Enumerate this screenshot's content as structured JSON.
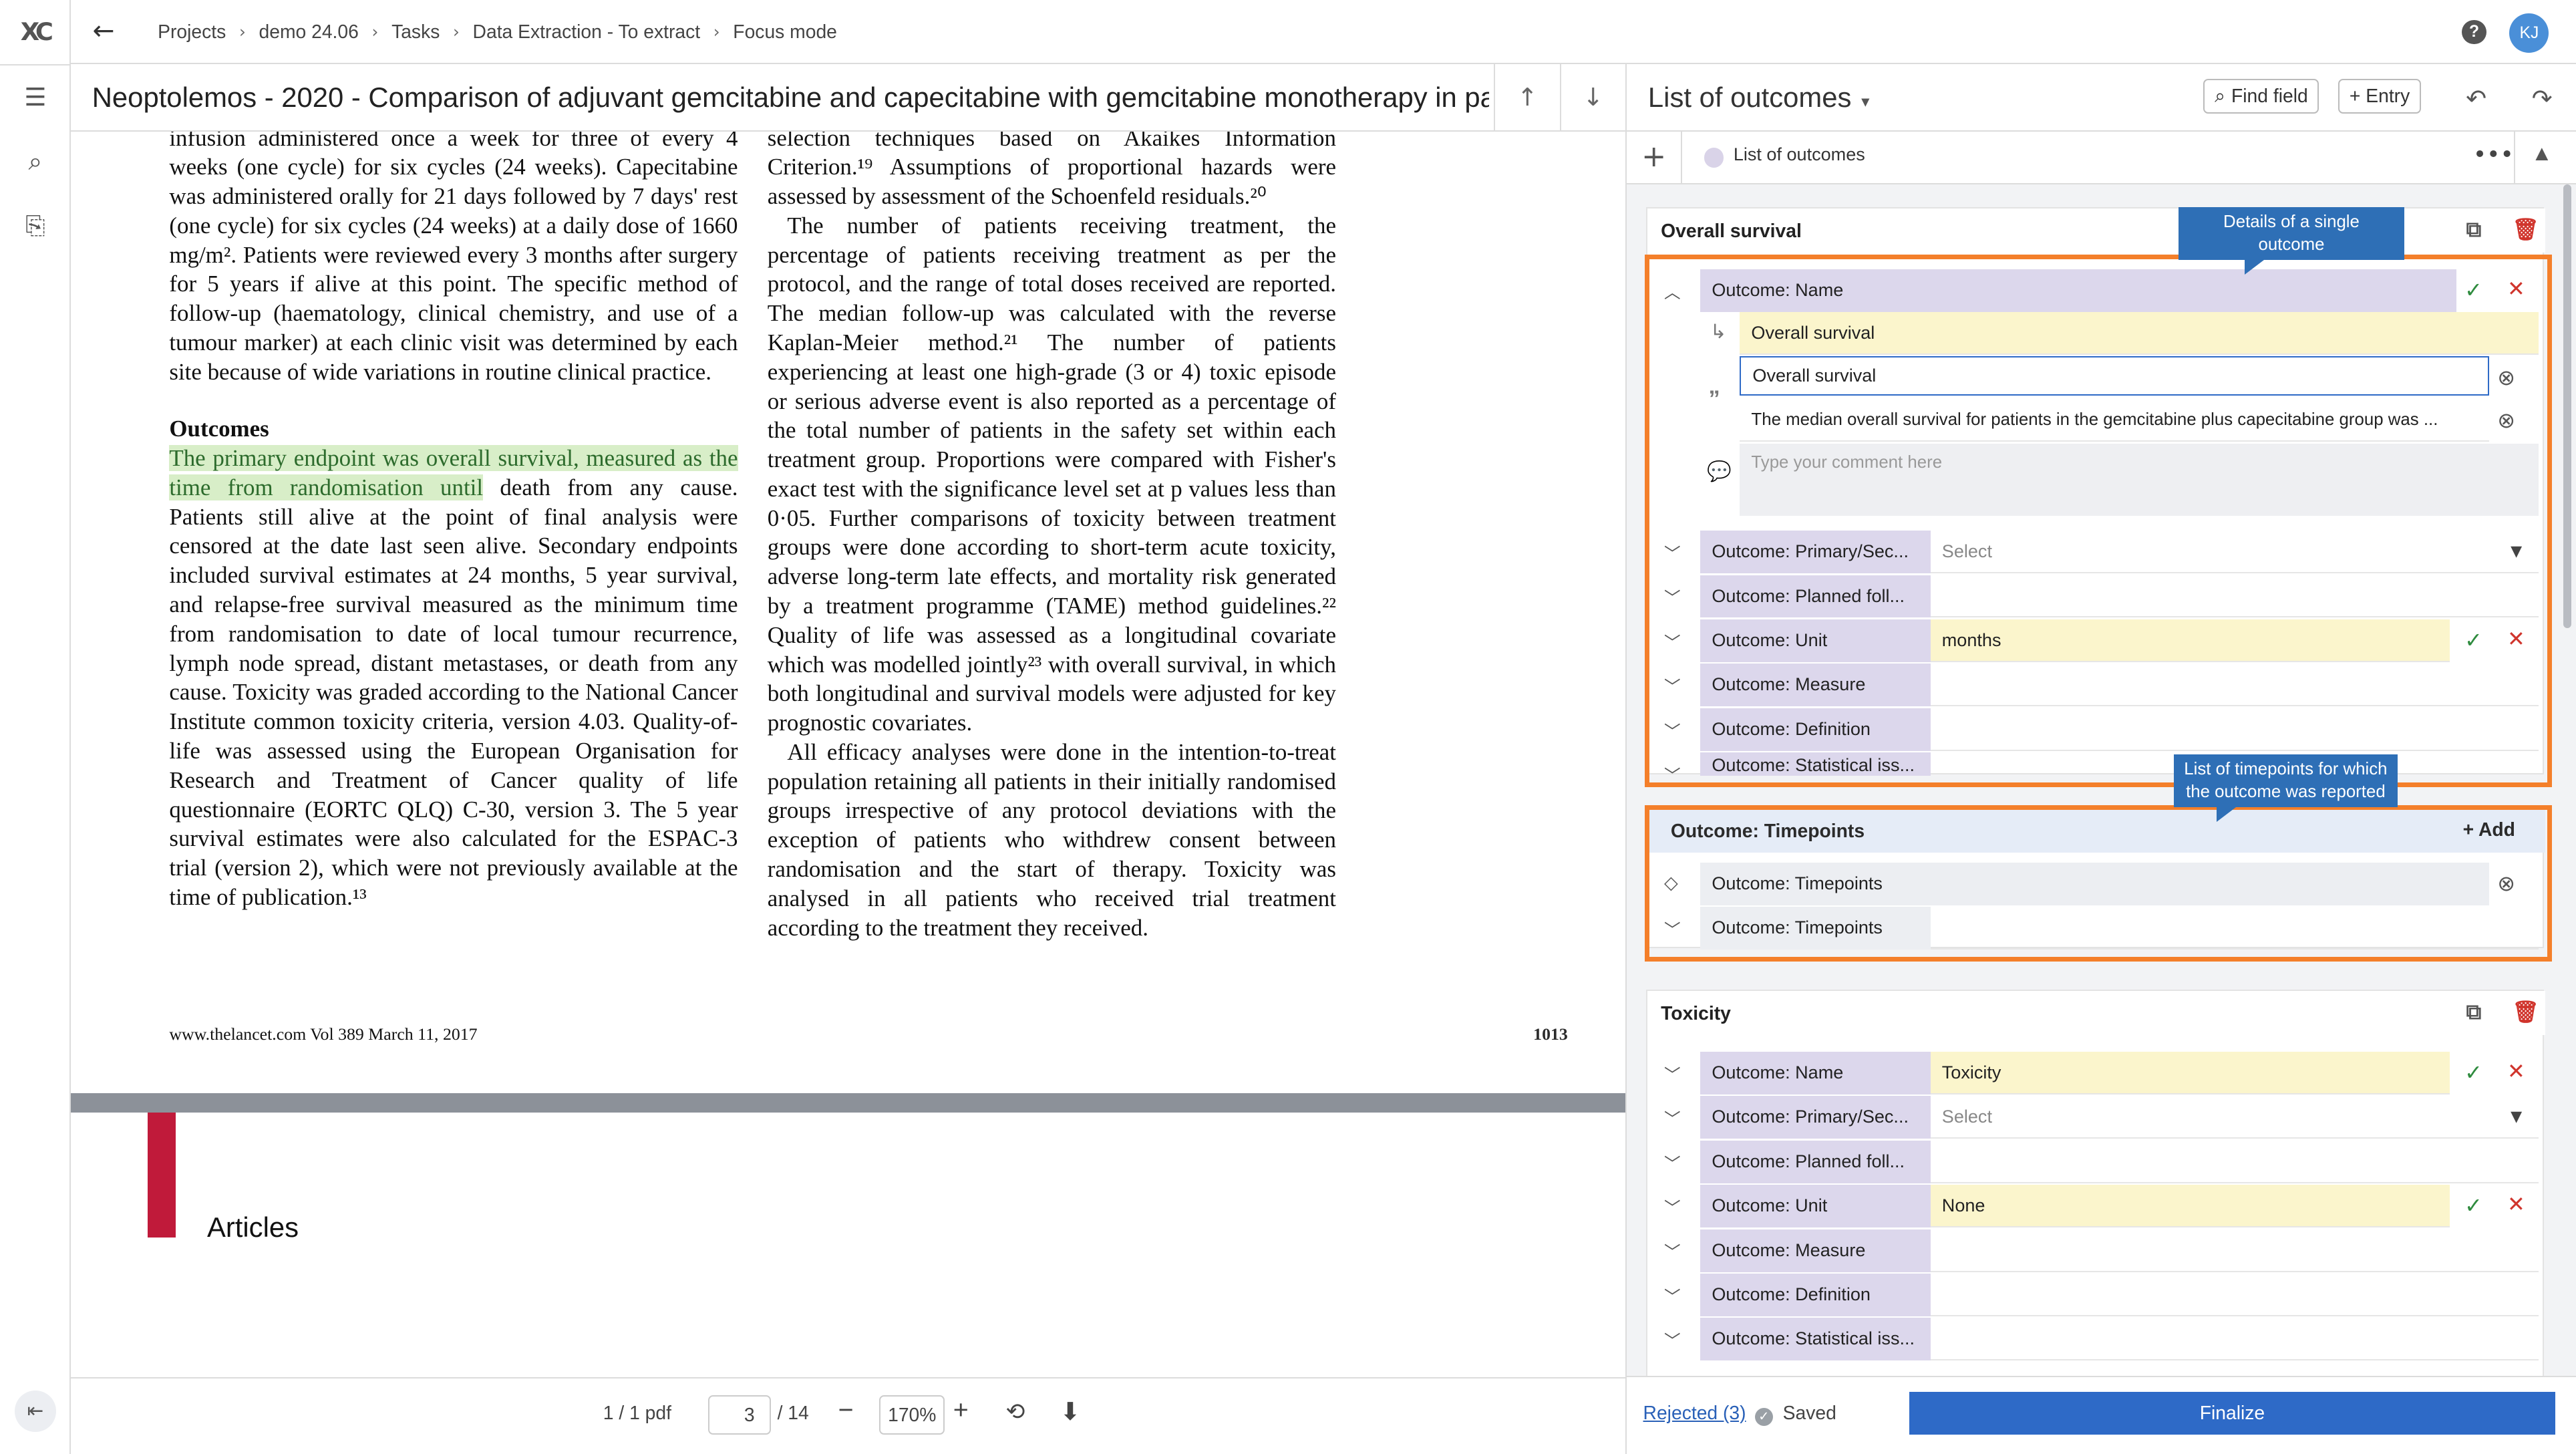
{
  "app": {
    "logo": "XC"
  },
  "breadcrumb": [
    "Projects",
    "demo 24.06",
    "Tasks",
    "Data Extraction - To extract",
    "Focus mode"
  ],
  "user": {
    "initials": "KJ"
  },
  "document": {
    "title": "Neoptolemos - 2020 - Comparison of adjuvant gemcitabine and capecitabine with gemcitabine monotherapy in pa...",
    "col1_intro": "infusion administered once a week for three of every 4 weeks (one cycle) for six cycles (24 weeks). Capecitabine was administered orally for 21 days followed by 7 days' rest (one cycle) for six cycles (24 weeks) at a daily dose of 1660 mg/m². Patients were reviewed every 3 months after surgery for 5 years if alive at this point. The specific method of follow-up (haematology, clinical chemistry, and use of a tumour marker) at each clinic visit was determined by each site because of wide variations in routine clinical practice.",
    "outcomes_heading": "Outcomes",
    "highlight": "The primary endpoint was overall survival, measured as the time from randomisation until",
    "col1_outcomes_rest": " death from any cause. Patients still alive at the point of final analysis were censored at the date last seen alive. Secondary endpoints included survival estimates at 24 months, 5 year survival, and relapse-free survival measured as the minimum time from randomisation to date of local tumour recurrence, lymph node spread, distant metastases, or death from any cause. Toxicity was graded according to the National Cancer Institute common toxicity criteria, version 4.03. Quality-of-life was assessed using the European Organisation for Research and Treatment of Cancer quality of life questionnaire (EORTC QLQ) C-30, version 3. The 5 year survival estimates were also calculated for the ESPAC-3 trial (version 2), which were not previously available at the time of publication.¹³",
    "col2_p1": "selection techniques based on Akaikes Information Criterion.¹⁹ Assumptions of proportional hazards were assessed by assessment of the Schoenfeld residuals.²⁰",
    "col2_p2": "The number of patients receiving treatment, the percentage of patients receiving treatment as per the protocol, and the range of total doses received are reported. The median follow-up was calculated with the reverse Kaplan-Meier method.²¹ The number of patients experiencing at least one high-grade (3 or 4) toxic episode or serious adverse event is also reported as a percentage of the total number of patients in the safety set within each treatment group. Proportions were compared with Fisher's exact test with the significance level set at p values less than 0·05. Further comparisons of toxicity between treatment groups were done according to short-term acute toxicity, adverse long-term late effects, and mortality risk generated by a treatment programme (TAME) method guidelines.²² Quality of life was assessed as a longitudinal covariate which was modelled jointly²³ with overall survival, in which both longitudinal and survival models were adjusted for key prognostic covariates.",
    "col2_p3": "All efficacy analyses were done in the intention-to-treat population retaining all patients in their initially randomised groups irrespective of any protocol deviations with the exception of patients who withdrew consent between randomisation and the start of therapy. Toxicity was analysed in all patients who received trial treatment according to the treatment they received.",
    "footer": "www.thelancet.com  Vol 389  March 11, 2017",
    "page_number": "1013",
    "next_page_heading": "Articles"
  },
  "pdf_toolbar": {
    "file": "1 / 1 pdf",
    "page": "3",
    "total": "/ 14",
    "zoom": "170%"
  },
  "panel": {
    "title": "List of outcomes",
    "find_field": "Find field",
    "entry": "Entry",
    "list_label": "List of outcomes",
    "callout_details": "Details of a single outcome",
    "callout_timepoints": "List of timepoints for which the outcome was reported",
    "card1": {
      "title": "Overall survival",
      "name_label": "Outcome: Name",
      "suggested": "Overall survival",
      "value": "Overall survival",
      "quote": "The median overall survival for patients in the gemcitabine plus capecitabine group was ...",
      "comment_placeholder": "Type your comment here",
      "rows": [
        {
          "label": "Outcome: Primary/Sec...",
          "value": "Select"
        },
        {
          "label": "Outcome: Planned foll...",
          "value": ""
        },
        {
          "label": "Outcome: Unit",
          "value": "months"
        },
        {
          "label": "Outcome: Measure",
          "value": ""
        },
        {
          "label": "Outcome: Definition",
          "value": ""
        },
        {
          "label": "Outcome: Statistical iss...",
          "value": ""
        }
      ]
    },
    "timepoints": {
      "title": "Outcome: Timepoints",
      "add": "Add",
      "row1": "Outcome: Timepoints",
      "row2": "Outcome: Timepoints"
    },
    "card2": {
      "title": "Toxicity",
      "rows": [
        {
          "label": "Outcome: Name",
          "value": "Toxicity"
        },
        {
          "label": "Outcome: Primary/Sec...",
          "value": "Select"
        },
        {
          "label": "Outcome: Planned foll...",
          "value": ""
        },
        {
          "label": "Outcome: Unit",
          "value": "None"
        },
        {
          "label": "Outcome: Measure",
          "value": ""
        },
        {
          "label": "Outcome: Definition",
          "value": ""
        },
        {
          "label": "Outcome: Statistical iss...",
          "value": ""
        }
      ]
    },
    "rejected": "Rejected (3)",
    "saved": "Saved",
    "finalize": "Finalize"
  },
  "colors": {
    "accent": "#2e6ac7",
    "highlight_box": "#f47f2a",
    "label_bg": "#dcd7ec",
    "value_yellow": "#fbf5cc"
  }
}
